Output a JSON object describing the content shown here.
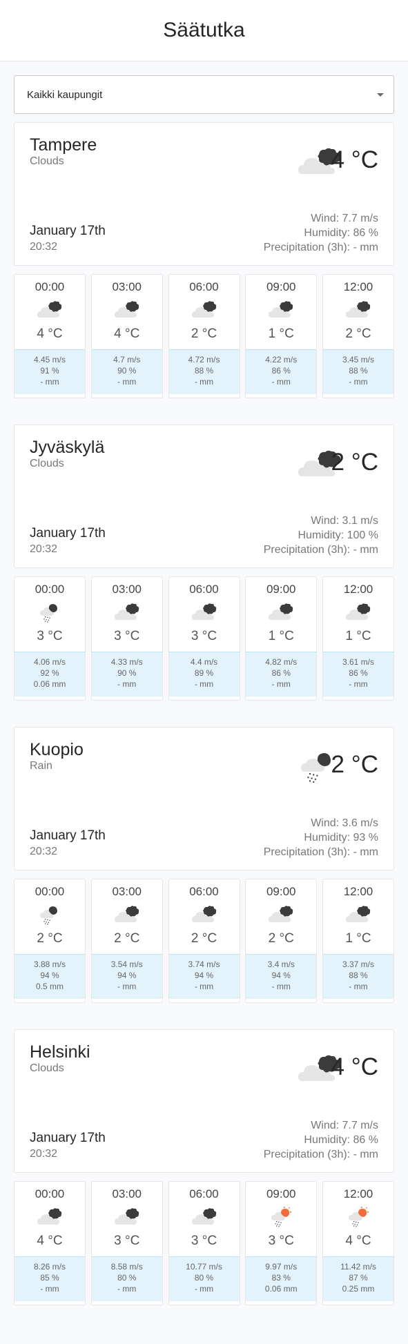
{
  "header": {
    "title": "Säätutka"
  },
  "select": {
    "value": "Kaikki kaupungit"
  },
  "colors": {
    "forecast_bg": "#e3f3fb",
    "sun": "#f26c3a",
    "cloud": "#e5e5e5",
    "dark_cloud": "#3b3b3b"
  },
  "cities": [
    {
      "name": "Tampere",
      "desc": "Clouds",
      "icon": "clouds-icon",
      "temp": "4 °C",
      "date": "January 17th",
      "time": "20:32",
      "wind": "Wind: 7.7 m/s",
      "humidity": "Humidity: 86 %",
      "precip": "Precipitation (3h): - mm",
      "forecast": [
        {
          "time": "00:00",
          "icon": "clouds-icon",
          "temp": "4 °C",
          "wind": "4.45 m/s",
          "hum": "91 %",
          "prec": "- mm"
        },
        {
          "time": "03:00",
          "icon": "clouds-icon",
          "temp": "4 °C",
          "wind": "4.7 m/s",
          "hum": "90 %",
          "prec": "- mm"
        },
        {
          "time": "06:00",
          "icon": "clouds-icon",
          "temp": "2 °C",
          "wind": "4.72 m/s",
          "hum": "88 %",
          "prec": "- mm"
        },
        {
          "time": "09:00",
          "icon": "clouds-icon",
          "temp": "1 °C",
          "wind": "4.22 m/s",
          "hum": "86 %",
          "prec": "- mm"
        },
        {
          "time": "12:00",
          "icon": "clouds-icon",
          "temp": "2 °C",
          "wind": "3.45 m/s",
          "hum": "88 %",
          "prec": "- mm"
        }
      ]
    },
    {
      "name": "Jyväskylä",
      "desc": "Clouds",
      "icon": "clouds-icon",
      "temp": "2 °C",
      "date": "January 17th",
      "time": "20:32",
      "wind": "Wind: 3.1 m/s",
      "humidity": "Humidity: 100 %",
      "precip": "Precipitation (3h): - mm",
      "forecast": [
        {
          "time": "00:00",
          "icon": "rain-icon",
          "temp": "3 °C",
          "wind": "4.06 m/s",
          "hum": "92 %",
          "prec": "0.06 mm"
        },
        {
          "time": "03:00",
          "icon": "clouds-icon",
          "temp": "3 °C",
          "wind": "4.33 m/s",
          "hum": "90 %",
          "prec": "- mm"
        },
        {
          "time": "06:00",
          "icon": "clouds-icon",
          "temp": "3 °C",
          "wind": "4.4 m/s",
          "hum": "89 %",
          "prec": "- mm"
        },
        {
          "time": "09:00",
          "icon": "clouds-icon",
          "temp": "1 °C",
          "wind": "4.82 m/s",
          "hum": "86 %",
          "prec": "- mm"
        },
        {
          "time": "12:00",
          "icon": "clouds-icon",
          "temp": "1 °C",
          "wind": "3.61 m/s",
          "hum": "86 %",
          "prec": "- mm"
        }
      ]
    },
    {
      "name": "Kuopio",
      "desc": "Rain",
      "icon": "rain-icon",
      "temp": "2 °C",
      "date": "January 17th",
      "time": "20:32",
      "wind": "Wind: 3.6 m/s",
      "humidity": "Humidity: 93 %",
      "precip": "Precipitation (3h): - mm",
      "forecast": [
        {
          "time": "00:00",
          "icon": "rain-icon",
          "temp": "2 °C",
          "wind": "3.88 m/s",
          "hum": "94 %",
          "prec": "0.5 mm"
        },
        {
          "time": "03:00",
          "icon": "clouds-icon",
          "temp": "2 °C",
          "wind": "3.54 m/s",
          "hum": "94 %",
          "prec": "- mm"
        },
        {
          "time": "06:00",
          "icon": "clouds-icon",
          "temp": "2 °C",
          "wind": "3.74 m/s",
          "hum": "94 %",
          "prec": "- mm"
        },
        {
          "time": "09:00",
          "icon": "clouds-icon",
          "temp": "2 °C",
          "wind": "3.4 m/s",
          "hum": "94 %",
          "prec": "- mm"
        },
        {
          "time": "12:00",
          "icon": "clouds-icon",
          "temp": "1 °C",
          "wind": "3.37 m/s",
          "hum": "88 %",
          "prec": "- mm"
        }
      ]
    },
    {
      "name": "Helsinki",
      "desc": "Clouds",
      "icon": "clouds-icon",
      "temp": "4 °C",
      "date": "January 17th",
      "time": "20:32",
      "wind": "Wind: 7.7 m/s",
      "humidity": "Humidity: 86 %",
      "precip": "Precipitation (3h): - mm",
      "forecast": [
        {
          "time": "00:00",
          "icon": "clouds-icon",
          "temp": "4 °C",
          "wind": "8.26 m/s",
          "hum": "85 %",
          "prec": "- mm"
        },
        {
          "time": "03:00",
          "icon": "clouds-icon",
          "temp": "3 °C",
          "wind": "8.58 m/s",
          "hum": "80 %",
          "prec": "- mm"
        },
        {
          "time": "06:00",
          "icon": "clouds-icon",
          "temp": "3 °C",
          "wind": "10.77 m/s",
          "hum": "80 %",
          "prec": "- mm"
        },
        {
          "time": "09:00",
          "icon": "sun-rain-icon",
          "temp": "3 °C",
          "wind": "9.97 m/s",
          "hum": "83 %",
          "prec": "0.06 mm"
        },
        {
          "time": "12:00",
          "icon": "sun-rain-icon",
          "temp": "4 °C",
          "wind": "11.42 m/s",
          "hum": "87 %",
          "prec": "0.25 mm"
        }
      ]
    }
  ]
}
